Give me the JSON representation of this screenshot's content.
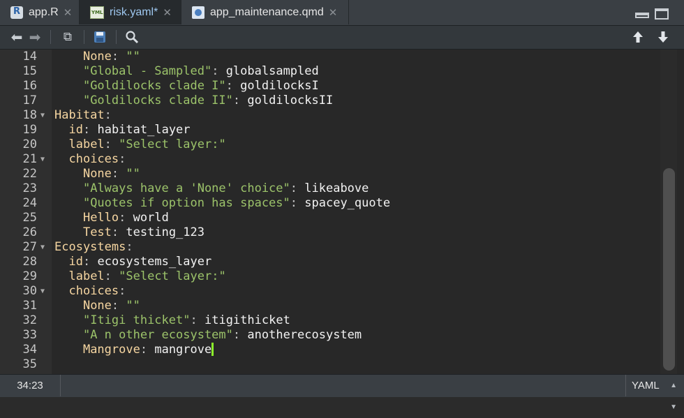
{
  "tabs": [
    {
      "label": "app.R",
      "icon": "r-file-icon",
      "active": false
    },
    {
      "label": "risk.yaml*",
      "icon": "yaml-file-icon",
      "active": true
    },
    {
      "label": "app_maintenance.qmd",
      "icon": "quarto-file-icon",
      "active": false
    }
  ],
  "toolbar": {
    "back_icon": "arrow-left-icon",
    "forward_icon": "arrow-right-icon",
    "show_in_window_icon": "popout-icon",
    "save_icon": "save-icon",
    "find_icon": "search-icon",
    "go_up_icon": "arrow-up-icon",
    "go_down_icon": "arrow-down-icon"
  },
  "editor": {
    "lines": [
      {
        "n": "14",
        "fold": false,
        "indent": "    ",
        "key": "None",
        "sep": ":",
        "str": "\"\"",
        "val": ""
      },
      {
        "n": "15",
        "fold": false,
        "indent": "    ",
        "key": "",
        "strkey": "\"Global - Sampled\"",
        "sep": ":",
        "str": "",
        "val": "globalsampled"
      },
      {
        "n": "16",
        "fold": false,
        "indent": "    ",
        "key": "",
        "strkey": "\"Goldilocks clade I\"",
        "sep": ":",
        "str": "",
        "val": "goldilocksI"
      },
      {
        "n": "17",
        "fold": false,
        "indent": "    ",
        "key": "",
        "strkey": "\"Goldilocks clade II\"",
        "sep": ":",
        "str": "",
        "val": "goldilocksII"
      },
      {
        "n": "18",
        "fold": true,
        "indent": "",
        "key": "Habitat",
        "sep": ":",
        "str": "",
        "val": ""
      },
      {
        "n": "19",
        "fold": false,
        "indent": "  ",
        "key": "id",
        "sep": ":",
        "str": "",
        "val": "habitat_layer"
      },
      {
        "n": "20",
        "fold": false,
        "indent": "  ",
        "key": "label",
        "sep": ":",
        "str": "\"Select layer:\"",
        "val": ""
      },
      {
        "n": "21",
        "fold": true,
        "indent": "  ",
        "key": "choices",
        "sep": ":",
        "str": "",
        "val": ""
      },
      {
        "n": "22",
        "fold": false,
        "indent": "    ",
        "key": "None",
        "sep": ":",
        "str": "\"\"",
        "val": ""
      },
      {
        "n": "23",
        "fold": false,
        "indent": "    ",
        "key": "",
        "strkey": "\"Always have a 'None' choice\"",
        "sep": ":",
        "str": "",
        "val": "likeabove"
      },
      {
        "n": "24",
        "fold": false,
        "indent": "    ",
        "key": "",
        "strkey": "\"Quotes if option has spaces\"",
        "sep": ":",
        "str": "",
        "val": "spacey_quote"
      },
      {
        "n": "25",
        "fold": false,
        "indent": "    ",
        "key": "Hello",
        "sep": ":",
        "str": "",
        "val": "world"
      },
      {
        "n": "26",
        "fold": false,
        "indent": "    ",
        "key": "Test",
        "sep": ":",
        "str": "",
        "val": "testing_123"
      },
      {
        "n": "27",
        "fold": true,
        "indent": "",
        "key": "Ecosystems",
        "sep": ":",
        "str": "",
        "val": ""
      },
      {
        "n": "28",
        "fold": false,
        "indent": "  ",
        "key": "id",
        "sep": ":",
        "str": "",
        "val": "ecosystems_layer"
      },
      {
        "n": "29",
        "fold": false,
        "indent": "  ",
        "key": "label",
        "sep": ":",
        "str": "\"Select layer:\"",
        "val": ""
      },
      {
        "n": "30",
        "fold": true,
        "indent": "  ",
        "key": "choices",
        "sep": ":",
        "str": "",
        "val": ""
      },
      {
        "n": "31",
        "fold": false,
        "indent": "    ",
        "key": "None",
        "sep": ":",
        "str": "\"\"",
        "val": ""
      },
      {
        "n": "32",
        "fold": false,
        "indent": "    ",
        "key": "",
        "strkey": "\"Itigi thicket\"",
        "sep": ":",
        "str": "",
        "val": "itigithicket"
      },
      {
        "n": "33",
        "fold": false,
        "indent": "    ",
        "key": "",
        "strkey": "\"A n other ecosystem\"",
        "sep": ":",
        "str": "",
        "val": "anotherecosystem"
      },
      {
        "n": "34",
        "fold": false,
        "indent": "    ",
        "key": "Mangrove",
        "sep": ":",
        "str": "",
        "val": "mangrove",
        "cursor": true
      },
      {
        "n": "35",
        "fold": false,
        "indent": "",
        "key": "",
        "sep": "",
        "str": "",
        "val": ""
      }
    ]
  },
  "status": {
    "cursor_position": "34:23",
    "language": "YAML"
  },
  "colors": {
    "key": "#f6d6a1",
    "string": "#9cc36a",
    "value": "#f2f2f2",
    "cursor": "#8cf22b"
  }
}
